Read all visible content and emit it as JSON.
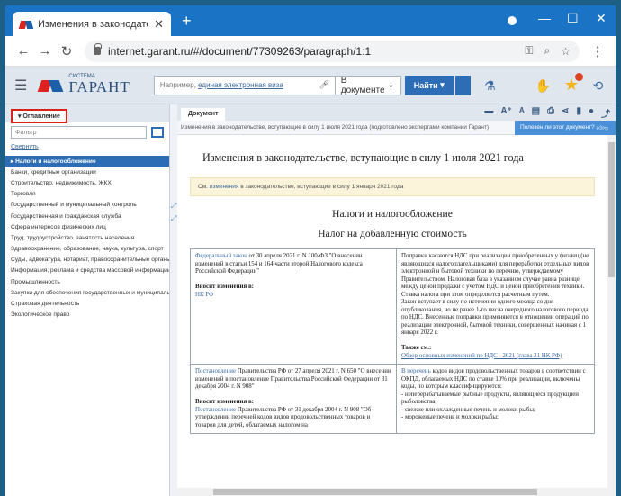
{
  "browser": {
    "tab_title": "Изменения в законодательстве",
    "tab_close": "✕",
    "new_tab": "+",
    "url": "internet.garant.ru/#/document/77309263/paragraph/1:1",
    "controls": {
      "minimize": "—",
      "maximize": "☐",
      "close": "✕"
    },
    "nav": {
      "back": "←",
      "forward": "→",
      "reload": "↻",
      "menu": "⋮",
      "key": "⚿",
      "zoom": "⌕",
      "star": "☆"
    }
  },
  "garant": {
    "logo_sub": "СИСТЕМА",
    "logo_word": "ГАРАНТ",
    "search_placeholder_prefix": "Например, ",
    "search_placeholder_link": "единая электронная виза",
    "scope": "В документе",
    "find_label": "Найти",
    "burger": "☰"
  },
  "left": {
    "tab_label": "Оглавление",
    "filter_placeholder": "Фильтр",
    "collapse": "Свернуть",
    "items": [
      "Налоги и налогообложение",
      "Банки, кредитные организации",
      "Строительство, недвижимость, ЖКХ",
      "Торговля",
      "Государственный и муниципальный контроль",
      "Государственная и гражданская служба",
      "Сфера интересов физических лиц",
      "Труд, трудоустройство, занятость населения",
      "Здравоохранение, образование, наука, культура, спорт",
      "Суды, адвокатура, нотариат, правоохранительные органы",
      "Информация, реклама и средства массовой информации",
      "Промышленность",
      "Закупки для обеспечения государственных и муниципальных нужд",
      "Страховая деятельность",
      "Экологическое право"
    ]
  },
  "doc": {
    "tab_label": "Документ",
    "breadcrumb": "Изменения в законодательстве, вступающие в силу 1 июля 2021 года (подготовлено экспертами компании Гарант)",
    "helpful": "Полезен ли этот документ?",
    "title": "Изменения в законодательстве, вступающие в силу 1 июля 2021 года",
    "notice_prefix": "См. ",
    "notice_link": "изменения",
    "notice_suffix": " в законодательстве, вступающие в силу 1 января 2021 года",
    "section_title": "Налоги и налогообложение",
    "subsection_title": "Налог на добавленную стоимость",
    "rows": [
      {
        "left_link": "Федеральный закон",
        "left_text": " от 30 апреля 2021 г. N 100-ФЗ \"О внесении изменений в статьи 154 и 164 части второй Налогового кодекса Российской Федерации\"",
        "left_label": "Вносит изменения в:",
        "left_ref": "НК РФ",
        "right_text": "Поправки касаются НДС при реализации приобретенных у физлиц (не являющихся налогоплательщиками) для переработки отдельных видов электронной и бытовой техники по перечню, утверждаемому Правительством. Налоговая база в указанном случае равна разнице между ценой продажи с учетом НДС и ценой приобретения техники. Ставка налога при этом определяется расчетным путем.",
        "right_text2": "Закон вступает в силу по истечении одного месяца со дня опубликования, но не ранее 1-го числа очередного налогового периода по НДС. Внесенные поправки применяются в отношении операций по реализации электронной, бытовой техники, совершенных начиная с 1 января 2022 г.",
        "right_label": "Также см.:",
        "right_link": "Обзор основных изменений по НДС - 2021 (глава 21 НК РФ)"
      },
      {
        "left_link": "Постановление",
        "left_text": " Правительства РФ от 27 апреля 2021 г. N 650 \"О внесении изменений в постановление Правительства Российской Федерации от 31 декабря 2004 г. N 908\"",
        "left_label": "Вносит изменения в:",
        "left_link2": "Постановление",
        "left_text2": " Правительства РФ от 31 декабря 2004 г. N 908 \"Об утверждении перечней кодов видов продовольственных товаров и товаров для детей, облагаемых налогом на",
        "right_link": "В перечень",
        "right_text": " кодов видов продовольственных товаров в соответствии с ОКПД, облагаемых НДС по ставке 10% при реализации, включены коды, по которым классифицируются:",
        "right_b1": "- неперерабатываемые рыбные продукты, являющиеся продукцией рыболовства;",
        "right_b2": "- свежие или охлажденные печень и молоки рыбы;",
        "right_b3": "- мороженые печень и молоки рыбы;"
      }
    ]
  }
}
